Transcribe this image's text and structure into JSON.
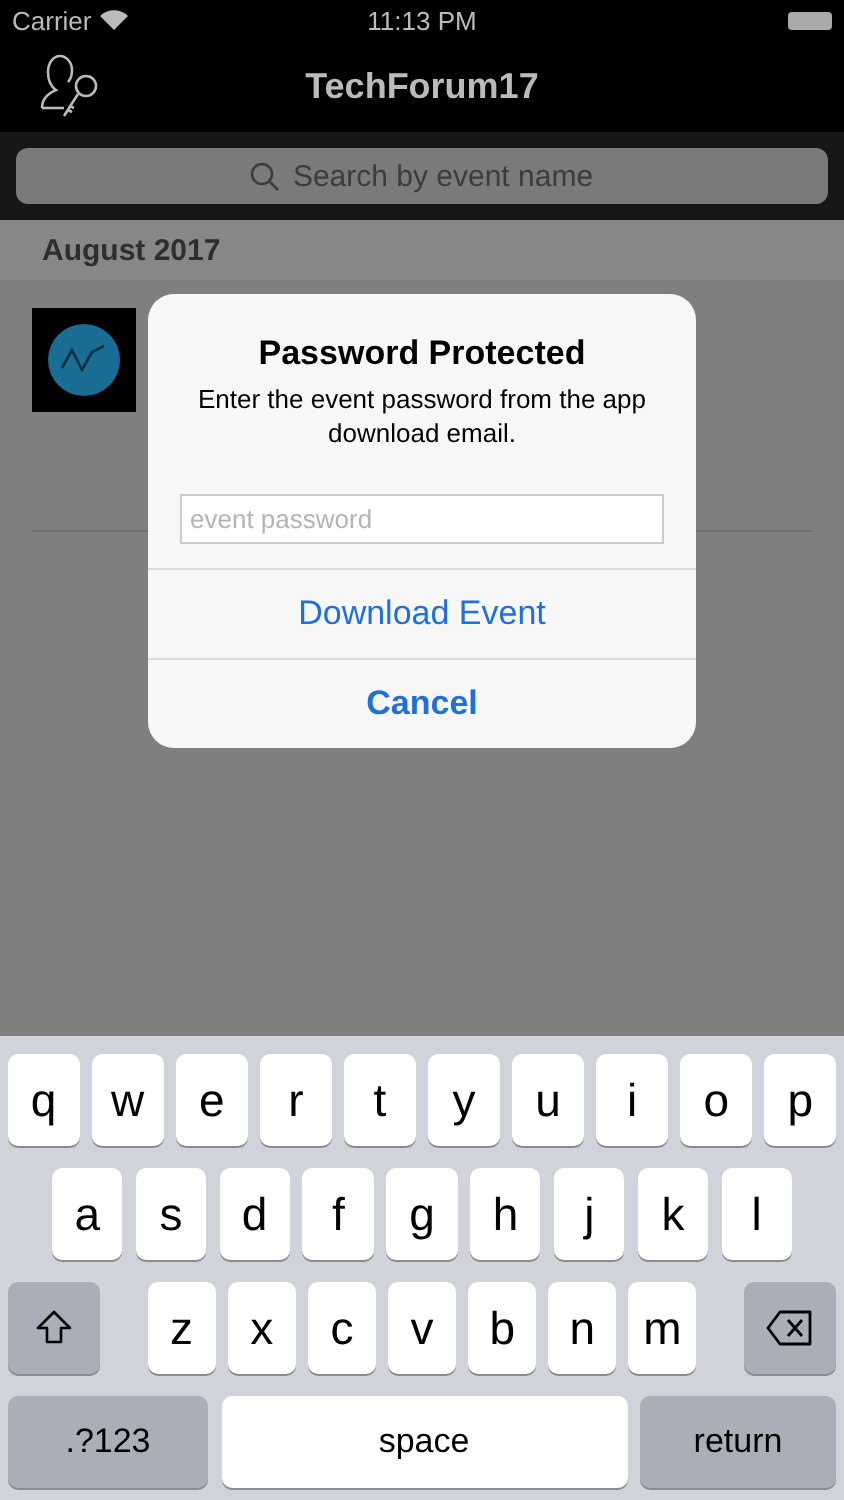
{
  "status_bar": {
    "carrier": "Carrier",
    "time": "11:13 PM"
  },
  "nav": {
    "title": "TechForum17"
  },
  "search": {
    "placeholder": "Search by event name"
  },
  "sections": [
    {
      "header": "August 2017"
    }
  ],
  "dialog": {
    "title": "Password Protected",
    "message": "Enter the event password from the app download email.",
    "field": {
      "placeholder": "event password"
    },
    "actions": [
      {
        "label": "Download Event",
        "bold": false
      },
      {
        "label": "Cancel",
        "bold": true
      }
    ]
  },
  "keyboard": {
    "rows": [
      {
        "keys": [
          {
            "kind": "letter",
            "label": "q"
          },
          {
            "kind": "letter",
            "label": "w"
          },
          {
            "kind": "letter",
            "label": "e"
          },
          {
            "kind": "letter",
            "label": "r"
          },
          {
            "kind": "letter",
            "label": "t"
          },
          {
            "kind": "letter",
            "label": "y"
          },
          {
            "kind": "letter",
            "label": "u"
          },
          {
            "kind": "letter",
            "label": "i"
          },
          {
            "kind": "letter",
            "label": "o"
          },
          {
            "kind": "letter",
            "label": "p"
          }
        ]
      },
      {
        "keys": [
          {
            "kind": "letter",
            "label": "a"
          },
          {
            "kind": "letter",
            "label": "s"
          },
          {
            "kind": "letter",
            "label": "d"
          },
          {
            "kind": "letter",
            "label": "f"
          },
          {
            "kind": "letter",
            "label": "g"
          },
          {
            "kind": "letter",
            "label": "h"
          },
          {
            "kind": "letter",
            "label": "j"
          },
          {
            "kind": "letter",
            "label": "k"
          },
          {
            "kind": "letter",
            "label": "l"
          }
        ]
      },
      {
        "keys": [
          {
            "kind": "shift"
          },
          {
            "kind": "letter",
            "label": "z"
          },
          {
            "kind": "letter",
            "label": "x"
          },
          {
            "kind": "letter",
            "label": "c"
          },
          {
            "kind": "letter",
            "label": "v"
          },
          {
            "kind": "letter",
            "label": "b"
          },
          {
            "kind": "letter",
            "label": "n"
          },
          {
            "kind": "letter",
            "label": "m"
          },
          {
            "kind": "backspace"
          }
        ]
      },
      {
        "keys": [
          {
            "kind": "mode",
            "label": ".?123"
          },
          {
            "kind": "space",
            "label": "space"
          },
          {
            "kind": "return",
            "label": "return"
          }
        ]
      }
    ]
  }
}
